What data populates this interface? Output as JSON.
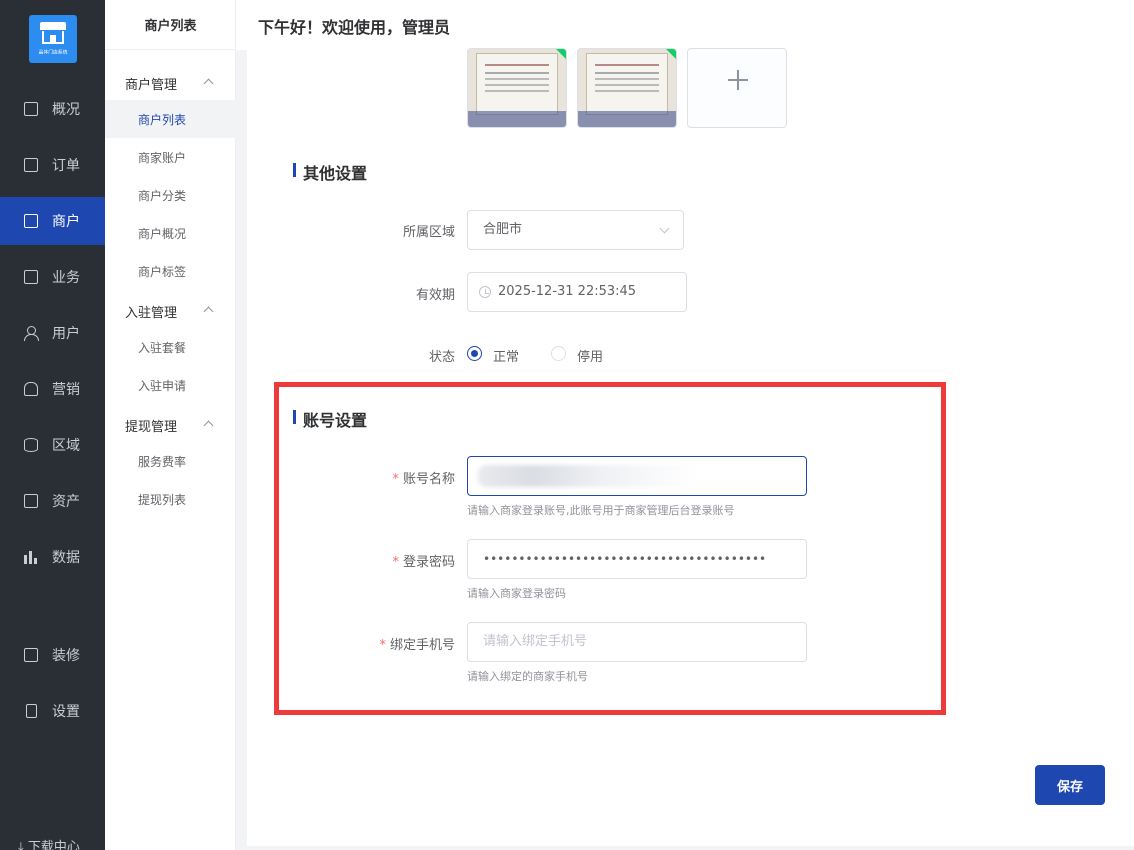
{
  "header": {
    "greeting": "下午好！欢迎使用，管理员"
  },
  "logo": {
    "text": "晶体门店系统"
  },
  "sidebar": {
    "items": [
      {
        "label": "概况",
        "icon": "chart-icon"
      },
      {
        "label": "订单",
        "icon": "order-icon"
      },
      {
        "label": "商户",
        "icon": "store-icon",
        "active": true
      },
      {
        "label": "业务",
        "icon": "business-icon"
      },
      {
        "label": "用户",
        "icon": "user-icon"
      },
      {
        "label": "营销",
        "icon": "marketing-icon"
      },
      {
        "label": "区域",
        "icon": "region-icon"
      },
      {
        "label": "资产",
        "icon": "asset-icon"
      },
      {
        "label": "数据",
        "icon": "data-icon"
      },
      {
        "label": "装修",
        "icon": "decorate-icon"
      },
      {
        "label": "设置",
        "icon": "settings-icon"
      }
    ],
    "download": "下载中心"
  },
  "submenu": {
    "title": "商户列表",
    "groups": [
      {
        "label": "商户管理",
        "items": [
          "商户列表",
          "商家账户",
          "商户分类",
          "商户概况",
          "商户标签"
        ]
      },
      {
        "label": "入驻管理",
        "items": [
          "入驻套餐",
          "入驻申请"
        ]
      },
      {
        "label": "提现管理",
        "items": [
          "服务费率",
          "提现列表"
        ]
      }
    ]
  },
  "form": {
    "other_settings": {
      "title": "其他设置",
      "region_label": "所属区域",
      "region_value": "合肥市",
      "expiry_label": "有效期",
      "expiry_value": "2025-12-31 22:53:45",
      "status_label": "状态",
      "status_options": [
        "正常",
        "停用"
      ],
      "status_selected": "正常"
    },
    "account_settings": {
      "title": "账号设置",
      "account_label": "账号名称",
      "account_hint": "请输入商家登录账号,此账号用于商家管理后台登录账号",
      "password_label": "登录密码",
      "password_value": "••••••••••••••••••••••••••••••••••••••••",
      "password_hint": "请输入商家登录密码",
      "phone_label": "绑定手机号",
      "phone_placeholder": "请输入绑定手机号",
      "phone_hint": "请输入绑定的商家手机号"
    },
    "save_label": "保存"
  },
  "colors": {
    "primary": "#1f47b0",
    "sidebar_bg": "#2a2f36",
    "highlight_border": "#ed3b3b"
  }
}
